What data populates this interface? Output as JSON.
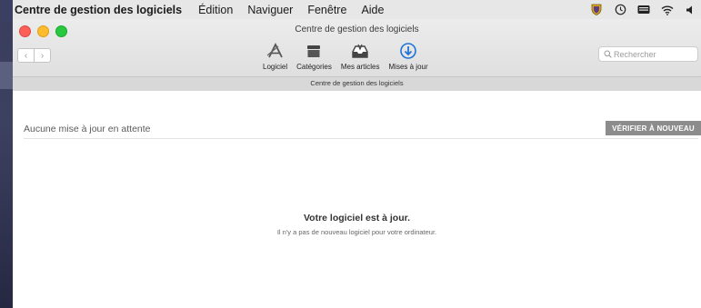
{
  "menubar": {
    "app_name": "Centre de gestion des logiciels",
    "items": [
      "Édition",
      "Naviguer",
      "Fenêtre",
      "Aide"
    ],
    "status_icons": [
      "shield-icon",
      "time-machine-icon",
      "keyboard-icon",
      "wifi-icon",
      "volume-icon"
    ]
  },
  "window": {
    "title": "Centre de gestion des logiciels",
    "subtitle": "Centre de gestion des logiciels"
  },
  "toolbar": {
    "back_label": "‹",
    "forward_label": "›",
    "tabs": [
      {
        "label": "Logiciel",
        "icon": "app-icon"
      },
      {
        "label": "Catégories",
        "icon": "box-icon"
      },
      {
        "label": "Mes articles",
        "icon": "tray-icon"
      },
      {
        "label": "Mises à jour",
        "icon": "download-icon"
      }
    ],
    "search_placeholder": "Rechercher"
  },
  "content": {
    "pending_label": "Aucune mise à jour en attente",
    "check_button": "VÉRIFIER À NOUVEAU",
    "message_title": "Votre logiciel est à jour.",
    "message_subtitle": "Il n'y a pas de nouveau logiciel pour votre ordinateur."
  },
  "colors": {
    "accent": "#1f72d8",
    "button_bg": "#8c8c8c"
  }
}
